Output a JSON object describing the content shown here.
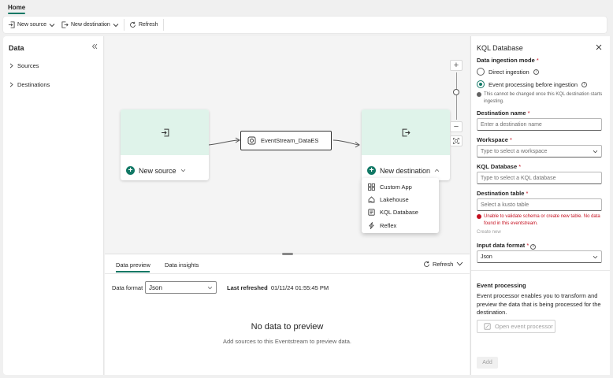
{
  "tabs": {
    "home": "Home"
  },
  "toolbar": {
    "new_source": "New source",
    "new_destination": "New destination",
    "refresh": "Refresh"
  },
  "left": {
    "title": "Data",
    "items": [
      "Sources",
      "Destinations"
    ]
  },
  "canvas": {
    "source_node": "New source",
    "eventstream": "EventStream_DataES",
    "dest_node": "New destination",
    "menu": [
      "Custom App",
      "Lakehouse",
      "KQL Database",
      "Reflex"
    ]
  },
  "bottom": {
    "tabs": [
      "Data preview",
      "Data insights"
    ],
    "refresh": "Refresh",
    "format_label": "Data format",
    "format_value": "Json",
    "last_refreshed_label": "Last refreshed",
    "last_refreshed_value": "01/11/24 01:55:45 PM",
    "no_data": "No data to preview",
    "no_data_sub": "Add sources to this Eventstream to preview data."
  },
  "right": {
    "title": "KQL Database",
    "ingestion_label": "Data ingestion mode",
    "mode_direct": "Direct ingestion",
    "mode_event": "Event processing before ingestion",
    "mode_note": "This cannot be changed once this KQL destination starts ingesting.",
    "dest_name_label": "Destination name",
    "dest_name_placeholder": "Enter a destination name",
    "workspace_label": "Workspace",
    "workspace_placeholder": "Type to select a workspace",
    "kql_db_label": "KQL Database",
    "kql_db_placeholder": "Type to select a KQL database",
    "dest_table_label": "Destination table",
    "dest_table_placeholder": "Select a kusto table",
    "error_text": "Unable to validate schema or create new table. No data found in this eventstream.",
    "create_new": "Create new",
    "input_format_label": "Input data format",
    "input_format_value": "Json",
    "ep_title": "Event processing",
    "ep_desc": "Event processor enables you to transform and preview the data that is being processed for the destination.",
    "ep_button": "Open event processor",
    "add_button": "Add",
    "required_mark": "*"
  },
  "colors": {
    "accent": "#117865",
    "node_header": "#dff3ea",
    "error": "#c50f1f"
  }
}
